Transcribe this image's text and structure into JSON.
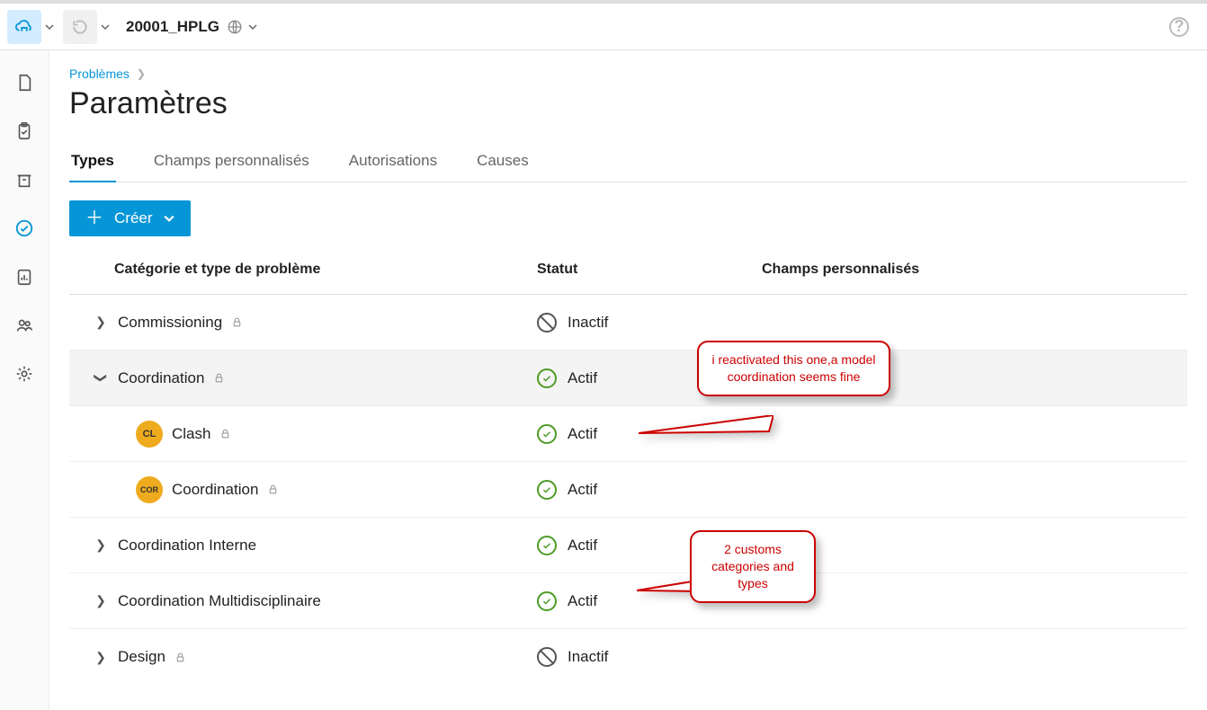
{
  "header": {
    "project_name": "20001_HPLG"
  },
  "breadcrumb": {
    "root": "Problèmes"
  },
  "page": {
    "title": "Paramètres"
  },
  "tabs": [
    {
      "label": "Types",
      "active": true
    },
    {
      "label": "Champs personnalisés",
      "active": false
    },
    {
      "label": "Autorisations",
      "active": false
    },
    {
      "label": "Causes",
      "active": false
    }
  ],
  "toolbar": {
    "create_label": "Créer"
  },
  "table": {
    "headers": {
      "category": "Catégorie et type de problème",
      "status": "Statut",
      "custom": "Champs personnalisés"
    },
    "status_labels": {
      "active": "Actif",
      "inactive": "Inactif"
    },
    "rows": [
      {
        "kind": "category",
        "label": "Commissioning",
        "locked": true,
        "expanded": false,
        "status": "inactive"
      },
      {
        "kind": "category",
        "label": "Coordination",
        "locked": true,
        "expanded": true,
        "status": "active"
      },
      {
        "kind": "type",
        "label": "Clash",
        "badge": "CL",
        "locked": true,
        "status": "active"
      },
      {
        "kind": "type",
        "label": "Coordination",
        "badge": "COR",
        "locked": true,
        "status": "active"
      },
      {
        "kind": "category",
        "label": "Coordination Interne",
        "locked": false,
        "expanded": false,
        "status": "active"
      },
      {
        "kind": "category",
        "label": "Coordination Multidisciplinaire",
        "locked": false,
        "expanded": false,
        "status": "active"
      },
      {
        "kind": "category",
        "label": "Design",
        "locked": true,
        "expanded": false,
        "status": "inactive"
      }
    ]
  },
  "callouts": {
    "c1": "i reactivated this one,a model coordination seems fine",
    "c2": "2 customs categories and types"
  }
}
